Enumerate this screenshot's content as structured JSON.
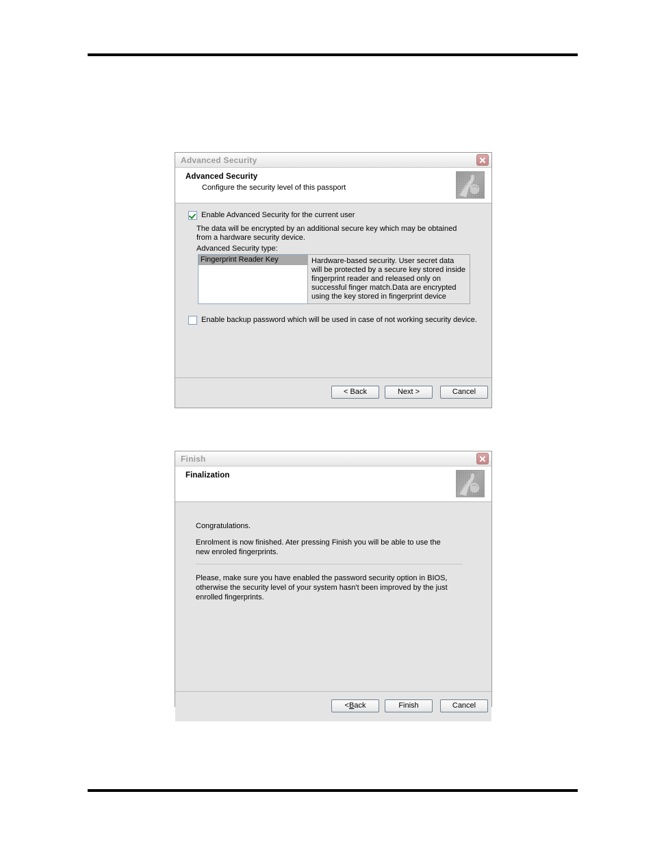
{
  "page": {
    "top_rule": true,
    "bottom_rule": true
  },
  "dialogs": [
    {
      "id": "advanced-security",
      "titlebar": {
        "title": "Advanced Security",
        "close_label": "Close"
      },
      "header": {
        "title": "Advanced Security",
        "subtitle": "Configure the security level of this passport",
        "thumbnail": "fingerprint-hand-image"
      },
      "enable_checkbox": {
        "label": "Enable Advanced Security for the current user",
        "checked": true
      },
      "description": "The data will be encrypted by an additional secure key which may be obtained from a hardware security device.",
      "type_label": "Advanced Security type:",
      "listbox": {
        "items": [
          "Fingerprint Reader Key"
        ],
        "selected": "Fingerprint Reader Key"
      },
      "type_description": "Hardware-based security. User secret data will be protected by a secure key stored inside fingerprint reader and released only on successful finger match.Data are encrypted using the key stored in fingerprint device",
      "backup_checkbox": {
        "label": "Enable backup password which will be used in case of not working security device.",
        "checked": false
      },
      "buttons": {
        "back": "< Back",
        "next": "Next >",
        "cancel": "Cancel"
      }
    },
    {
      "id": "finish",
      "titlebar": {
        "title": "Finish",
        "close_label": "Close"
      },
      "header": {
        "title": "Finalization",
        "subtitle": "",
        "thumbnail": "fingerprint-hand-image"
      },
      "congratulations": "Congratulations.",
      "enrolment_text": "Enrolment is now finished.  Ater pressing Finish you will be able to use the new enroled fingerprints.",
      "bios_warning": "Please, make sure you have enabled the password security option in BIOS, otherwise the security level of your system hasn't been improved by the just enrolled fingerprints.",
      "buttons": {
        "back_prefix": "< ",
        "back_accel": "B",
        "back_suffix": "ack",
        "finish": "Finish",
        "cancel": "Cancel"
      }
    }
  ],
  "colors": {
    "dialog_face": "#e4e4e4",
    "header_band": "#ffffff",
    "title_text": "#9b9b9b",
    "close_button": "#cf9595",
    "check_green": "#1c8a2e",
    "selection_gray": "#a9a9a9",
    "rule_black": "#000000"
  }
}
